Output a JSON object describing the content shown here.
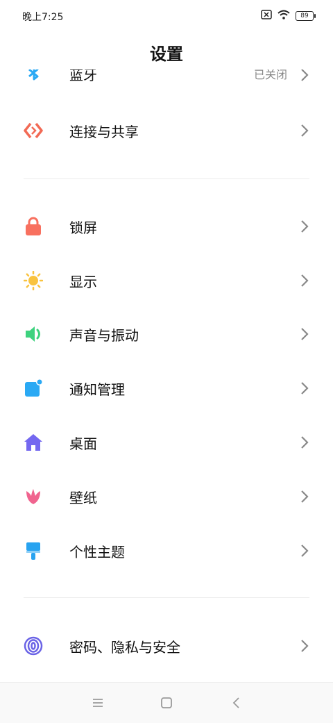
{
  "status_bar": {
    "time": "晚上7:25",
    "battery": "89"
  },
  "header": {
    "title": "设置"
  },
  "partial_item": {
    "label": "蓝牙",
    "value": "已关闭"
  },
  "items": [
    {
      "label": "连接与共享",
      "icon": "connection-share-icon",
      "color": "#f26a55"
    },
    {
      "label": "锁屏",
      "icon": "lock-icon",
      "color": "#f8705f"
    },
    {
      "label": "显示",
      "icon": "sun-icon",
      "color": "#f9c33f"
    },
    {
      "label": "声音与振动",
      "icon": "speaker-icon",
      "color": "#3ed27e"
    },
    {
      "label": "通知管理",
      "icon": "notification-icon",
      "color": "#2aa9f4"
    },
    {
      "label": "桌面",
      "icon": "home-icon",
      "color": "#7468f0"
    },
    {
      "label": "壁纸",
      "icon": "tulip-icon",
      "color": "#f0648f"
    },
    {
      "label": "个性主题",
      "icon": "brush-icon",
      "color": "#28a3f0"
    },
    {
      "label": "密码、隐私与安全",
      "icon": "fingerprint-icon",
      "color": "#6a63e6"
    }
  ],
  "nav": {
    "menu": "menu-icon",
    "home": "home-square-icon",
    "back": "back-icon"
  }
}
